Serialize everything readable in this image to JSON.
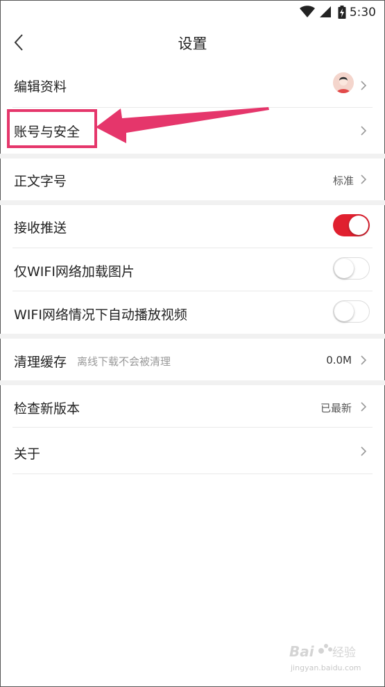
{
  "status_bar": {
    "time": "5:30",
    "icons": [
      "wifi-icon",
      "signal-icon",
      "battery-icon"
    ]
  },
  "header": {
    "title": "设置",
    "back_icon": "chevron-left-icon"
  },
  "rows": {
    "edit_profile": {
      "label": "编辑资料"
    },
    "account_security": {
      "label": "账号与安全"
    },
    "font_size": {
      "label": "正文字号",
      "value": "标准"
    },
    "push": {
      "label": "接收推送",
      "enabled": true
    },
    "wifi_images": {
      "label": "仅WIFI网络加载图片",
      "enabled": false
    },
    "wifi_video": {
      "label": "WIFI网络情况下自动播放视频",
      "enabled": false
    },
    "clear_cache": {
      "label": "清理缓存",
      "hint": "离线下载不会被清理",
      "value": "0.0M"
    },
    "check_update": {
      "label": "检查新版本",
      "value": "已最新"
    },
    "about": {
      "label": "关于"
    }
  },
  "colors": {
    "accent": "#e0202f",
    "annotation": "#e5366b"
  },
  "watermark": {
    "line1": "Baidu经验",
    "line2": "jingyan.baidu.com"
  }
}
